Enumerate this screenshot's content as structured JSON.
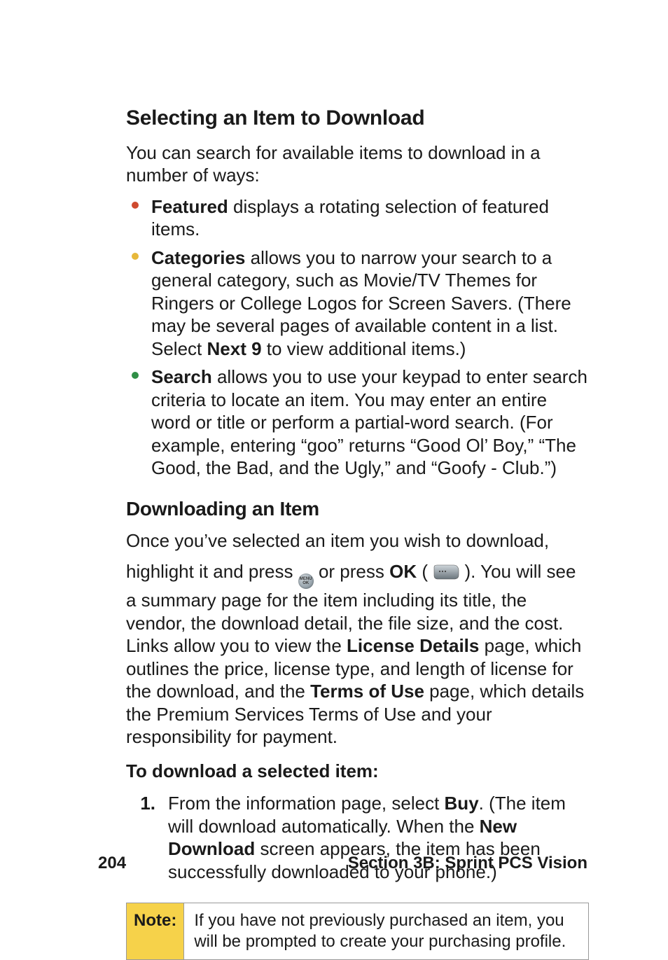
{
  "heading1": "Selecting an Item to Download",
  "intro": "You can search for available items to download in a number of ways:",
  "bullets": [
    {
      "bold": "Featured",
      "rest": " displays a rotating selection of featured items."
    },
    {
      "bold": "Categories",
      "rest": " allows you to narrow your search to a general category, such as Movie/TV Themes for Ringers or College Logos for Screen Savers. (There may be several pages of available content in a list. Select ",
      "bold2": "Next 9",
      "rest2": " to view additional items.)"
    },
    {
      "bold": "Search",
      "rest": " allows you to use your keypad to enter search criteria to locate an item. You may enter an entire word or title or perform a partial-word search. (For example, entering “goo” returns “Good Ol’ Boy,” “The Good, the Bad, and the Ugly,” and “Goofy - Club.”)"
    }
  ],
  "heading2": "Downloading an Item",
  "para2_lead": "Once you’ve selected an item you wish to download,",
  "para2": {
    "a": "highlight it and press ",
    "b": " or press ",
    "ok": "OK",
    "c": " (",
    "d": "). You will see a summary page for the item including its title, the vendor, the download detail, the file size, and the cost. Links allow you to view the ",
    "license": "License Details",
    "e": " page, which outlines the price, license type, and length of license for the download, and the ",
    "terms": "Terms of Use",
    "f": " page, which details the Premium Services Terms of Use and your responsibility for payment."
  },
  "lead": "To download a selected item:",
  "step": {
    "num": "1.",
    "a": "From the information page, select ",
    "buy": "Buy",
    "b": ". (The item will download automatically. When the ",
    "newdl": "New Download",
    "c": " screen appears, the item has been successfully downloaded to your phone.)"
  },
  "note": {
    "label": "Note:",
    "body": "If you have not previously purchased an item, you will be prompted to create your purchasing profile."
  },
  "footer": {
    "page": "204",
    "section": "Section 3B: Sprint PCS Vision"
  },
  "icons": {
    "menu_ok_top": "MENU",
    "menu_ok_bottom": "OK"
  }
}
